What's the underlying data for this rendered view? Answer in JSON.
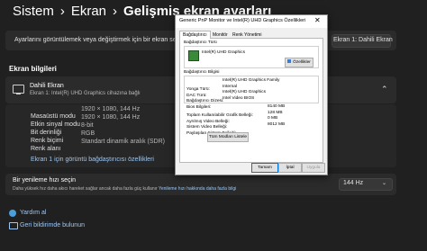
{
  "breadcrumb": {
    "part1": "Sistem",
    "part2": "Ekran",
    "current": "Gelişmiş ekran ayarları"
  },
  "select_display": {
    "label": "Ayarlarını görüntülemek veya değiştirmek için bir ekran seçin",
    "value": "Ekran 1: Dahili Ekran"
  },
  "display_info": {
    "section_title": "Ekran bilgileri",
    "name": "Dahili Ekran",
    "subtitle": "Ekran 1: Intel(R) UHD Graphics cihazına bağlı",
    "rows": [
      {
        "label": "Masaüstü modu",
        "value": "1920 × 1080, 144 Hz"
      },
      {
        "label": "Etkin sinyal modu",
        "value": "1920 × 1080, 144 Hz"
      },
      {
        "label": "Bit derinliği",
        "value": "8-bit"
      },
      {
        "label": "Renk biçimi",
        "value": "RGB"
      },
      {
        "label": "Renk alanı",
        "value": "Standart dinamik aralık (SDR)"
      }
    ],
    "adapter_link": "Ekran 1 için görüntü bağdaştırıcısı özellikleri"
  },
  "refresh": {
    "title": "Bir yenileme hızı seçin",
    "desc": "Daha yüksek hız daha akıcı hareket sağlar ancak daha fazla güç kullanır",
    "desc_link": "Yenileme hızı hakkında daha fazla bilgi",
    "value": "144 Hz"
  },
  "help": {
    "get_help": "Yardım al",
    "feedback": "Geri bildirimde bulunun"
  },
  "dialog": {
    "title": "Generic PnP Monitor ve Intel(R) UHD Graphics Özellikleri",
    "close": "✕",
    "tabs": [
      "Bağdaştırıcı",
      "Monitör",
      "Renk Yönetimi"
    ],
    "adapter_type_label": "Bağdaştırıcı Türü",
    "adapter_name": "Intel(R) UHD Graphics",
    "properties_button": "Özellikler",
    "adapter_info_label": "Bağdaştırıcı Bilgisi",
    "info_rows": [
      {
        "label": "Yonga Türü:",
        "value": "Intel(R) UHD Graphics Family"
      },
      {
        "label": "DAC Türü:",
        "value": "Internal"
      },
      {
        "label": "Bağdaştırıcı Dizesi:",
        "value": "Intel(R) UHD Graphics"
      },
      {
        "label": "Bios Bilgileri:",
        "value": "Intel Video BIOS"
      }
    ],
    "memory_rows": [
      {
        "label": "Toplam Kullanılabilir Grafik Belleği:",
        "value": "8140 MB"
      },
      {
        "label": "Ayrılmış Video Belleği:",
        "value": "128 MB"
      },
      {
        "label": "Sistem Video Belleği:",
        "value": "0 MB"
      },
      {
        "label": "Paylaşılan Sistem Belleği:",
        "value": "8012 MB"
      }
    ],
    "list_modes_button": "Tüm Modları Listele",
    "ok_button": "Tamam",
    "cancel_button": "İptal",
    "apply_button": "Uygula"
  },
  "colors": {
    "accent": "#4cc2ff",
    "link": "#9ac7f5",
    "background": "#202020",
    "card": "#2b2b2b"
  }
}
